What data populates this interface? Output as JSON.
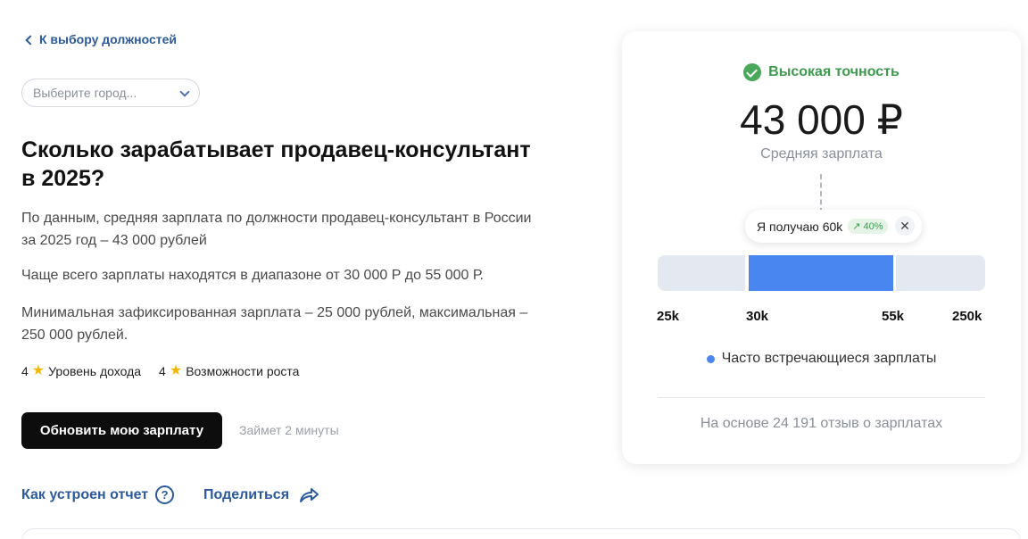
{
  "nav": {
    "back_label": "К выбору должностей"
  },
  "city_select": {
    "placeholder": "Выберите город..."
  },
  "headline": "Сколько зарабатывает продавец-консультант в 2025?",
  "paragraphs": [
    "По данным, средняя зарплата по должности продавец-консультант в России за 2025 год – 43 000 рублей",
    "Чаще всего зарплаты находятся в диапазоне от 30 000 Р до 55 000 Р.",
    "Минимальная зафиксированная зарплата – 25 000 рублей, максимальная – 250 000 рублей."
  ],
  "ratings": [
    {
      "score": "4",
      "label": "Уровень дохода"
    },
    {
      "score": "4",
      "label": "Возможности роста"
    }
  ],
  "actions": {
    "update_button": "Обновить мою зарплату",
    "time_note": "Займет 2 минуты",
    "report_link": "Как устроен отчет",
    "share_link": "Поделиться"
  },
  "card": {
    "accuracy": "Высокая точность",
    "salary": "43 000 ₽",
    "salary_label": "Средняя зарплата",
    "tooltip": {
      "text": "Я получаю 60k",
      "growth": "↗ 40%"
    },
    "ticks": [
      "25k",
      "30k",
      "55k",
      "250k"
    ],
    "legend": "Часто встречающиеся зарплаты",
    "reviews": "На основе 24 191 отзыв о зарплатах"
  },
  "colors": {
    "accent_blue": "#4a86f0",
    "link_blue": "#2b5a9c",
    "success_green": "#49a85a",
    "star": "#f5b800"
  }
}
